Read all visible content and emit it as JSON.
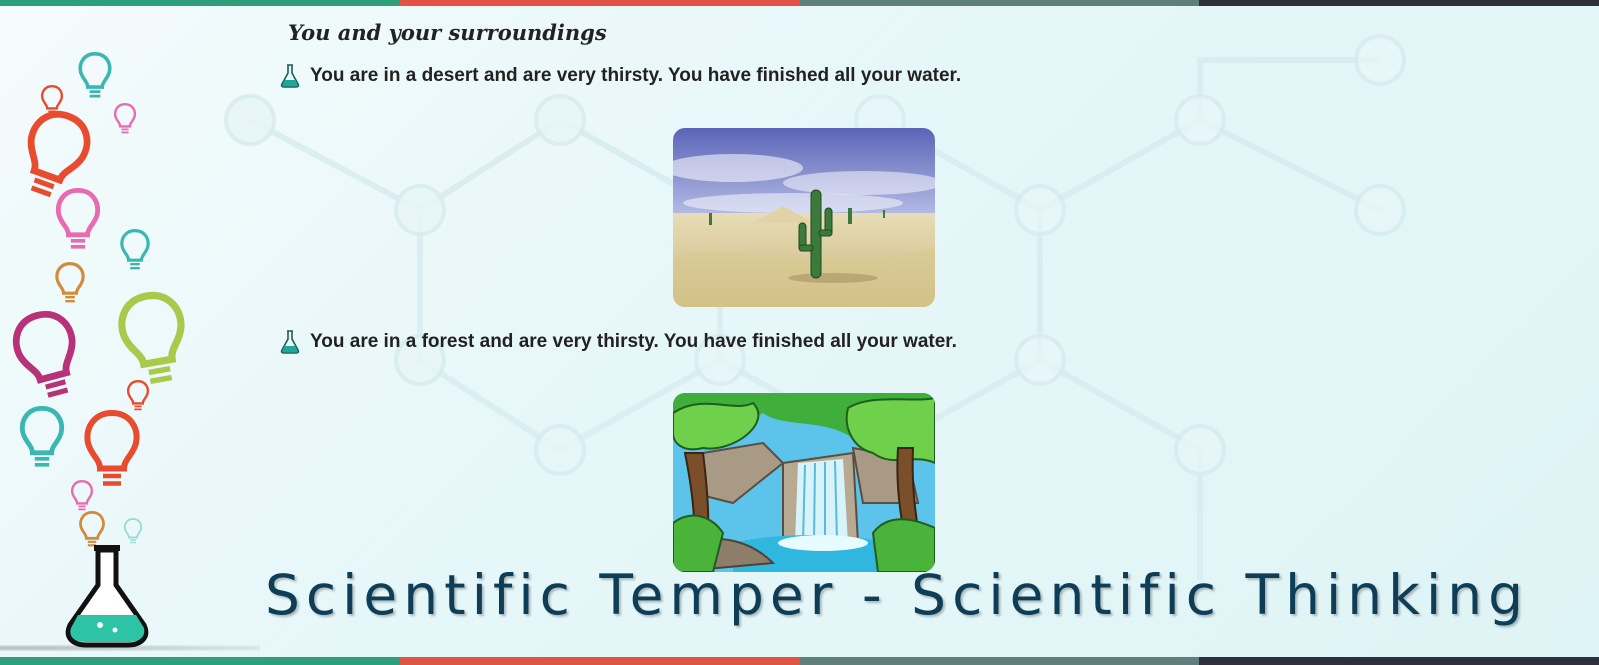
{
  "page": {
    "section_title": "You and your surroundings",
    "items": [
      {
        "text": "You are in a desert and are very thirsty. You have finished all your water.",
        "image": "desert-cactus-scene"
      },
      {
        "text": "You are in a forest and are very thirsty. You have finished all your water.",
        "image": "forest-waterfall-scene"
      }
    ],
    "footer_title": "Scientific Temper - Scientific Thinking"
  },
  "colors": {
    "top_stripes": [
      "#2f9e7a",
      "#e25345",
      "#5e7f7b",
      "#2d2f3b"
    ],
    "title_color": "#0e3d57",
    "background": "#e6f7f9"
  },
  "icons": {
    "bullet": "flask-icon",
    "decoration": [
      "lightbulb-icon",
      "lab-flask-icon"
    ]
  }
}
